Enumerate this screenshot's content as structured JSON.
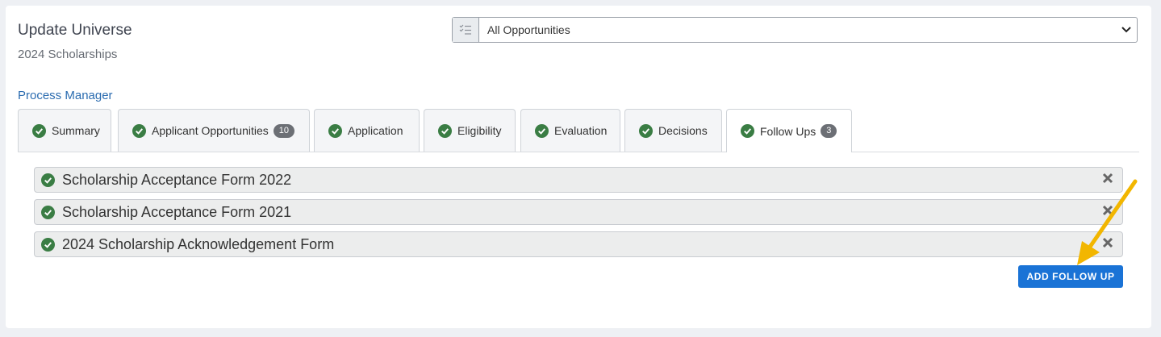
{
  "header": {
    "title": "Update Universe",
    "subtitle": "2024 Scholarships"
  },
  "filter": {
    "selected": "All Opportunities"
  },
  "process_manager_link": "Process Manager",
  "tabs": [
    {
      "label": "Summary"
    },
    {
      "label": "Applicant Opportunities",
      "count": "10"
    },
    {
      "label": "Application"
    },
    {
      "label": "Eligibility"
    },
    {
      "label": "Evaluation"
    },
    {
      "label": "Decisions"
    },
    {
      "label": "Follow Ups",
      "count": "3",
      "active": true
    }
  ],
  "followups": [
    "Scholarship Acceptance Form 2022",
    "Scholarship Acceptance Form 2021",
    "2024 Scholarship Acknowledgement Form"
  ],
  "add_button": "ADD FOLLOW UP",
  "colors": {
    "check": "#3a7d44",
    "button": "#1a73d6",
    "arrow": "#f2b600"
  },
  "icons": {
    "filter": "checklist-icon",
    "check": "check-circle-icon",
    "remove": "close-icon",
    "dropdown": "chevron-down-icon"
  }
}
